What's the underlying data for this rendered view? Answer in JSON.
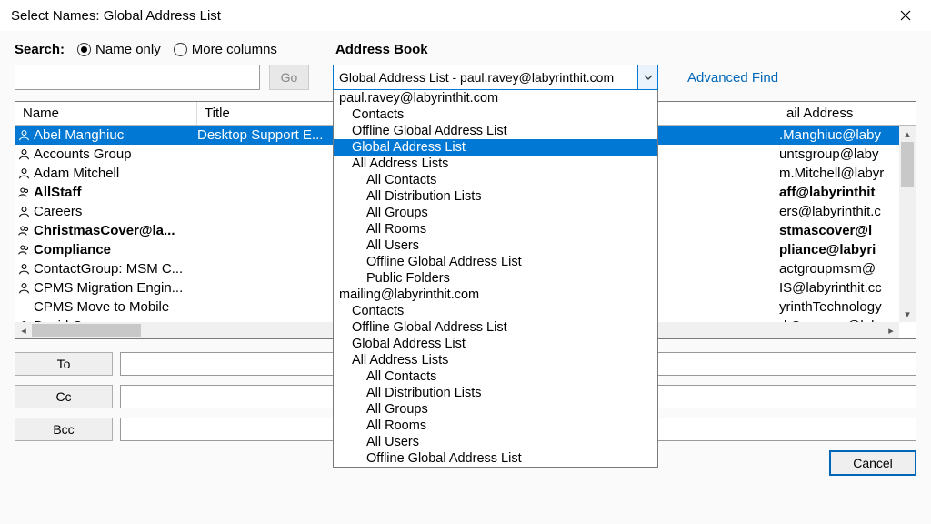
{
  "titlebar": {
    "title": "Select Names: Global Address List"
  },
  "search": {
    "label": "Search:",
    "radio_name": "Name only",
    "radio_cols": "More columns",
    "go": "Go"
  },
  "address_book": {
    "label": "Address Book",
    "value": "Global Address List - paul.ravey@labyrinthit.com",
    "advanced": "Advanced Find"
  },
  "dropdown": [
    {
      "text": "paul.ravey@labyrinthit.com",
      "indent": 0
    },
    {
      "text": "Contacts",
      "indent": 1
    },
    {
      "text": "Offline Global Address List",
      "indent": 1
    },
    {
      "text": "Global Address List",
      "indent": 1,
      "selected": true
    },
    {
      "text": "All Address Lists",
      "indent": 1
    },
    {
      "text": "All Contacts",
      "indent": 2
    },
    {
      "text": "All Distribution Lists",
      "indent": 2
    },
    {
      "text": "All Groups",
      "indent": 2
    },
    {
      "text": "All Rooms",
      "indent": 2
    },
    {
      "text": "All Users",
      "indent": 2
    },
    {
      "text": "Offline Global Address List",
      "indent": 2
    },
    {
      "text": "Public Folders",
      "indent": 2
    },
    {
      "text": "mailing@labyrinthit.com",
      "indent": 0
    },
    {
      "text": "Contacts",
      "indent": 1
    },
    {
      "text": "Offline Global Address List",
      "indent": 1
    },
    {
      "text": "Global Address List",
      "indent": 1
    },
    {
      "text": "All Address Lists",
      "indent": 1
    },
    {
      "text": "All Contacts",
      "indent": 2
    },
    {
      "text": "All Distribution Lists",
      "indent": 2
    },
    {
      "text": "All Groups",
      "indent": 2
    },
    {
      "text": "All Rooms",
      "indent": 2
    },
    {
      "text": "All Users",
      "indent": 2
    },
    {
      "text": "Offline Global Address List",
      "indent": 2
    }
  ],
  "columns": {
    "name": "Name",
    "title": "Title",
    "email": "ail Address"
  },
  "rows": [
    {
      "name": "Abel Manghiuc",
      "title": "Desktop Support E...",
      "selected": true,
      "icon": "person",
      "bold": false
    },
    {
      "name": "Accounts Group",
      "title": "",
      "icon": "person",
      "bold": false
    },
    {
      "name": "Adam Mitchell",
      "title": "",
      "icon": "person",
      "bold": false
    },
    {
      "name": "AllStaff",
      "title": "",
      "icon": "group",
      "bold": true
    },
    {
      "name": "Careers",
      "title": "",
      "icon": "person",
      "bold": false
    },
    {
      "name": "ChristmasCover@la...",
      "title": "",
      "icon": "group",
      "bold": true
    },
    {
      "name": "Compliance",
      "title": "",
      "icon": "group",
      "bold": true
    },
    {
      "name": "ContactGroup: MSM C...",
      "title": "",
      "icon": "person",
      "bold": false
    },
    {
      "name": "CPMS Migration Engin...",
      "title": "",
      "icon": "person",
      "bold": false
    },
    {
      "name": "CPMS Move to Mobile",
      "title": "",
      "icon": "none",
      "bold": false
    },
    {
      "name": "David Cameron",
      "title": "",
      "icon": "person",
      "bold": false
    }
  ],
  "emails": [
    {
      "text": ".Manghiuc@laby",
      "selected": true,
      "bold": false
    },
    {
      "text": "untsgroup@laby",
      "bold": false
    },
    {
      "text": "m.Mitchell@labyr",
      "bold": false
    },
    {
      "text": "aff@labyrinthit",
      "bold": true
    },
    {
      "text": "ers@labyrinthit.c",
      "bold": false
    },
    {
      "text": "stmascover@l",
      "bold": true
    },
    {
      "text": "pliance@labyri",
      "bold": true
    },
    {
      "text": "actgroupmsm@",
      "bold": false
    },
    {
      "text": "IS@labyrinthit.cc",
      "bold": false
    },
    {
      "text": "yrinthTechnology",
      "bold": false
    },
    {
      "text": "d Cameron@labv",
      "bold": false
    }
  ],
  "fields": {
    "to": "To",
    "cc": "Cc",
    "bcc": "Bcc"
  },
  "actions": {
    "cancel": "Cancel"
  }
}
